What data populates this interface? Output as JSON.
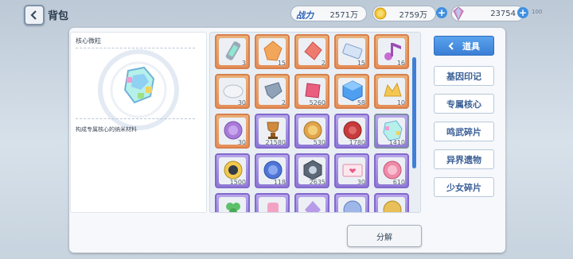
{
  "header": {
    "title": "背包"
  },
  "resources": [
    {
      "icon": "battle-power-icon",
      "label": "战力",
      "value": "2571万"
    },
    {
      "icon": "coin-icon",
      "value": "2759万"
    },
    {
      "icon": "gem-icon",
      "value": "23754"
    }
  ],
  "status_bar": {
    "battery": "100"
  },
  "detail": {
    "name": "核心微粒",
    "description": "构成专属核心的纳米材料"
  },
  "items": [
    [
      "3",
      "15",
      "2",
      "15",
      "16"
    ],
    [
      "30",
      "2",
      "5260",
      "58",
      "10"
    ],
    [
      "30",
      "21580",
      "530",
      "1780",
      "1410"
    ],
    [
      "1500",
      "118",
      "2635",
      "30",
      "610"
    ],
    [
      "",
      "",
      "",
      "",
      ""
    ]
  ],
  "tabs": [
    "道具",
    "基因印记",
    "专属核心",
    "鸣武碎片",
    "异界遗物",
    "少女碎片"
  ],
  "actions": {
    "decompose": "分解"
  },
  "colors": {
    "accent": "#3b7fd6",
    "orange_rarity": "#e58f59",
    "purple_rarity": "#8f78d6"
  }
}
